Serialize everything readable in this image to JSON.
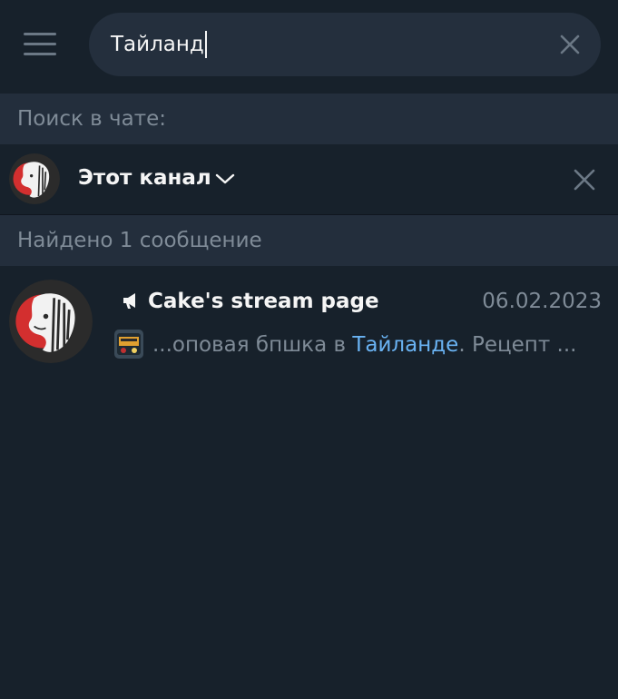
{
  "search": {
    "query": "Тайланд"
  },
  "search_in_chat": {
    "label": "Поиск в чате:"
  },
  "scope": {
    "label": "Этот канал"
  },
  "results_header": {
    "label": "Найдено 1 сообщение"
  },
  "results": [
    {
      "title": "Cake's stream page",
      "date": "06.02.2023",
      "snippet_before": "...оповая бпшка в ",
      "snippet_highlight": "Тайланде",
      "snippet_after": ". Рецепт ..."
    }
  ],
  "colors": {
    "background": "#17212b",
    "panel": "#232e3c",
    "search_field": "#242f3d",
    "muted_text": "#7f8b97",
    "highlight": "#6ab3f3",
    "brand_red": "#d32f2f"
  },
  "icons": {
    "menu": "hamburger-icon",
    "clear": "close-icon",
    "scope_dropdown": "chevron-down-icon",
    "channel": "megaphone-icon"
  }
}
